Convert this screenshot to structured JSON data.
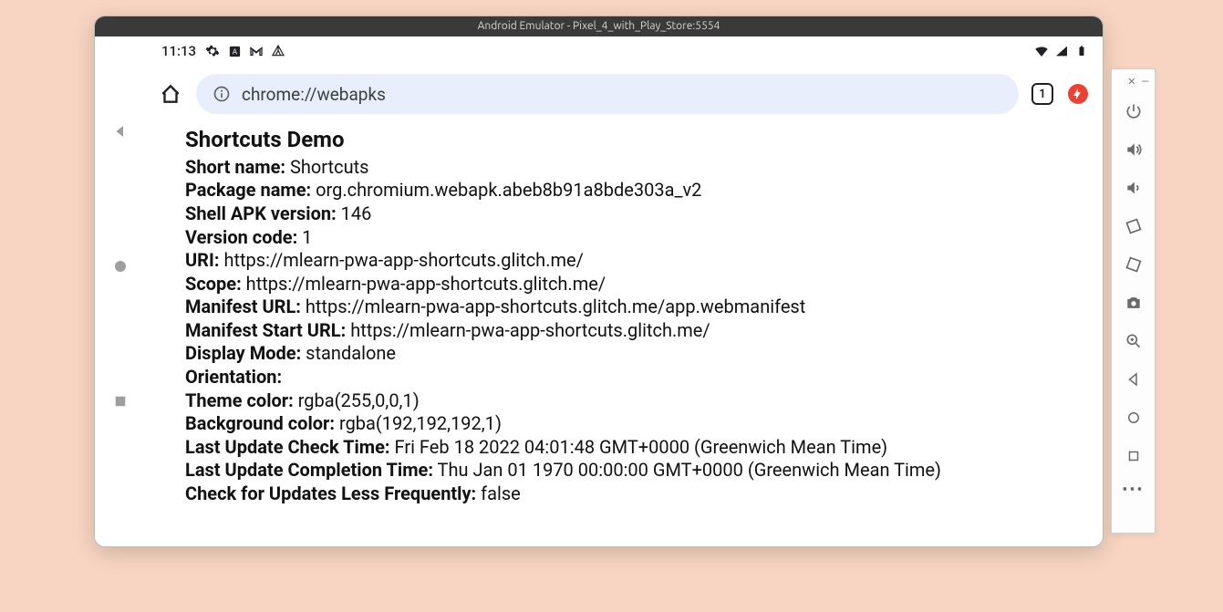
{
  "window": {
    "title": "Android Emulator - Pixel_4_with_Play_Store:5554"
  },
  "statusbar": {
    "time": "11:13"
  },
  "toolbar": {
    "url": "chrome://webapks",
    "tab_count": "1"
  },
  "page": {
    "title": "Shortcuts Demo",
    "rows": [
      {
        "label": "Short name:",
        "value": "Shortcuts"
      },
      {
        "label": "Package name:",
        "value": "org.chromium.webapk.abeb8b91a8bde303a_v2"
      },
      {
        "label": "Shell APK version:",
        "value": "146"
      },
      {
        "label": "Version code:",
        "value": "1"
      },
      {
        "label": "URI:",
        "value": "https://mlearn-pwa-app-shortcuts.glitch.me/"
      },
      {
        "label": "Scope:",
        "value": "https://mlearn-pwa-app-shortcuts.glitch.me/"
      },
      {
        "label": "Manifest URL:",
        "value": "https://mlearn-pwa-app-shortcuts.glitch.me/app.webmanifest"
      },
      {
        "label": "Manifest Start URL:",
        "value": "https://mlearn-pwa-app-shortcuts.glitch.me/"
      },
      {
        "label": "Display Mode:",
        "value": "standalone"
      },
      {
        "label": "Orientation:",
        "value": ""
      },
      {
        "label": "Theme color:",
        "value": "rgba(255,0,0,1)"
      },
      {
        "label": "Background color:",
        "value": "rgba(192,192,192,1)"
      },
      {
        "label": "Last Update Check Time:",
        "value": "Fri Feb 18 2022 04:01:48 GMT+0000 (Greenwich Mean Time)"
      },
      {
        "label": "Last Update Completion Time:",
        "value": "Thu Jan 01 1970 00:00:00 GMT+0000 (Greenwich Mean Time)"
      },
      {
        "label": "Check for Updates Less Frequently:",
        "value": "false"
      }
    ]
  }
}
